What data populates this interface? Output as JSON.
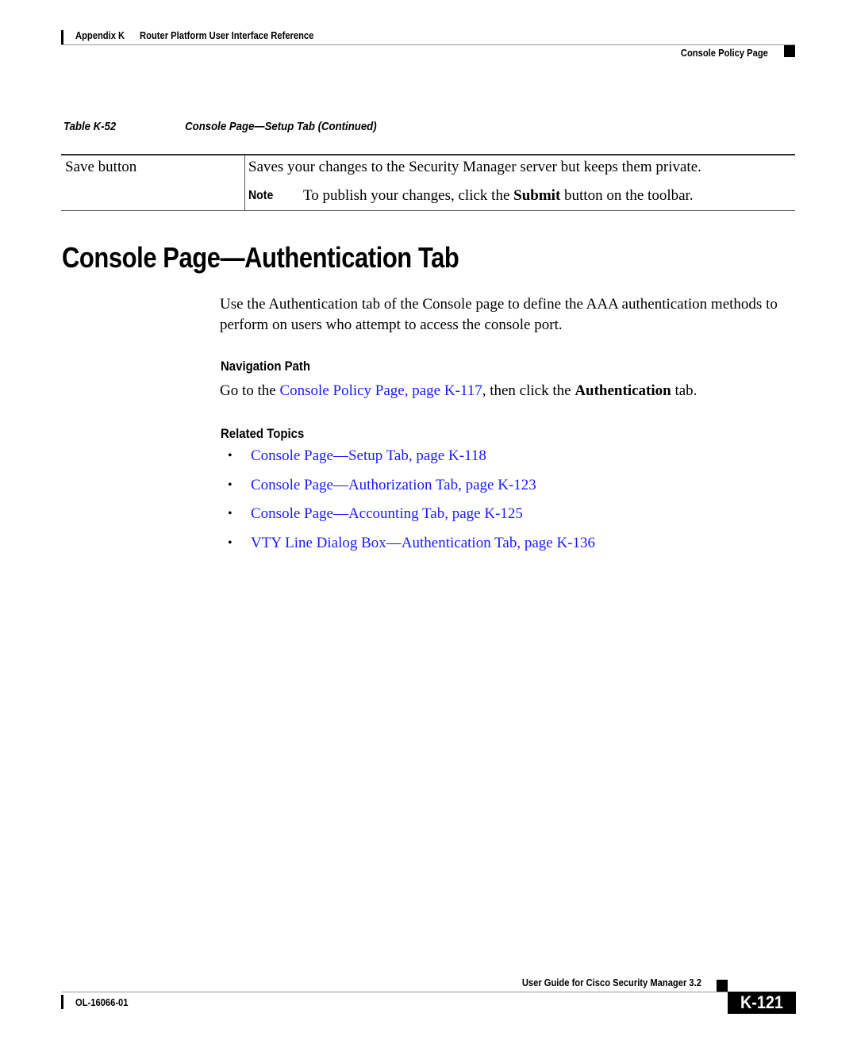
{
  "header": {
    "appendix": "Appendix K",
    "chapter_title": "Router Platform User Interface Reference",
    "section": "Console Policy Page"
  },
  "table": {
    "caption_label": "Table K-52",
    "caption_title": "Console Page—Setup Tab (Continued)",
    "rows": [
      {
        "element": "Save button",
        "description": "Saves your changes to the Security Manager server but keeps them private.",
        "note_label": "Note",
        "note_text_before": "To publish your changes, click the ",
        "note_bold": "Submit",
        "note_text_after": " button on the toolbar."
      }
    ]
  },
  "section": {
    "heading": "Console Page—Authentication Tab",
    "intro": "Use the Authentication tab of the Console page to define the AAA authentication methods to perform on users who attempt to access the console port.",
    "navigation": {
      "heading": "Navigation Path",
      "text_before": "Go to the ",
      "link": "Console Policy Page, page K-117",
      "text_middle": ", then click the ",
      "bold": "Authentication",
      "text_after": " tab."
    },
    "related": {
      "heading": "Related Topics",
      "items": [
        "Console Page—Setup Tab, page K-118",
        "Console Page—Authorization Tab, page K-123",
        "Console Page—Accounting Tab, page K-125",
        "VTY Line Dialog Box—Authentication Tab, page K-136"
      ]
    }
  },
  "footer": {
    "guide_title": "User Guide for Cisco Security Manager 3.2",
    "doc_number": "OL-16066-01",
    "page_number": "K-121"
  },
  "colors": {
    "link": "#1a1aff",
    "text": "#000000"
  }
}
